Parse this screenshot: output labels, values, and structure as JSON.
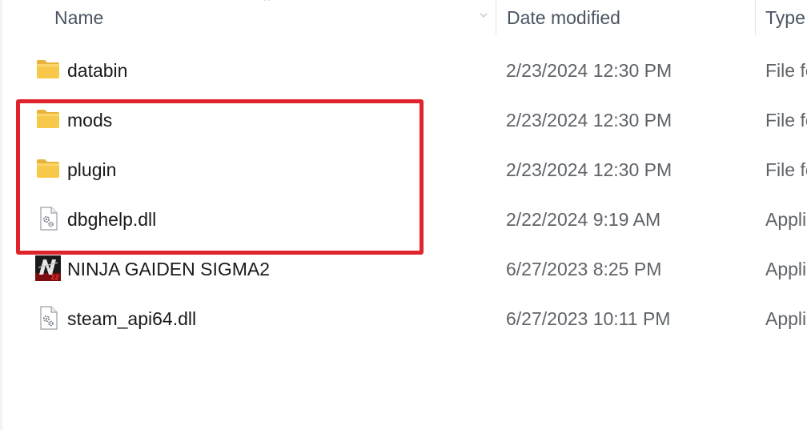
{
  "columns": {
    "name": "Name",
    "date_modified": "Date modified",
    "type": "Type"
  },
  "files": [
    {
      "name": "databin",
      "date": "2/23/2024 12:30 PM",
      "type": "File folder",
      "icon": "folder-icon"
    },
    {
      "name": "mods",
      "date": "2/23/2024 12:30 PM",
      "type": "File folder",
      "icon": "folder-icon"
    },
    {
      "name": "plugin",
      "date": "2/23/2024 12:30 PM",
      "type": "File folder",
      "icon": "folder-icon"
    },
    {
      "name": "dbghelp.dll",
      "date": "2/22/2024 9:19 AM",
      "type": "Application extension",
      "icon": "dll-file-icon"
    },
    {
      "name": "NINJA GAIDEN SIGMA2",
      "date": "6/27/2023 8:25 PM",
      "type": "Application",
      "icon": "ninja-gaiden-app-icon"
    },
    {
      "name": "steam_api64.dll",
      "date": "6/27/2023 10:11 PM",
      "type": "Application extension",
      "icon": "dll-file-icon"
    }
  ],
  "highlight": {
    "color": "#e0242b",
    "covers_rows": [
      "mods",
      "plugin",
      "dbghelp.dll"
    ]
  },
  "colors": {
    "folder": "#f8c84a",
    "header_text": "#4b5563",
    "detail_text": "#5f6368"
  }
}
